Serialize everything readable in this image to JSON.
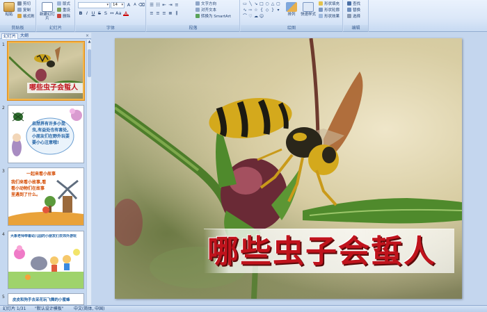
{
  "ribbon": {
    "clipboard": {
      "label": "剪贴板",
      "paste": "粘贴",
      "cut": "剪切",
      "copy": "复制",
      "format_painter": "格式刷"
    },
    "slides": {
      "label": "幻灯片",
      "new_slide": "新建幻灯片",
      "layout": "版式",
      "reset": "重设",
      "delete": "删除"
    },
    "font": {
      "label": "字体",
      "font_size": "14",
      "bold": "B",
      "italic": "I",
      "underline": "U",
      "strike": "S",
      "shadow": "S",
      "increase": "A",
      "decrease": "A"
    },
    "paragraph": {
      "label": "段落",
      "text_direction": "文字方向",
      "align_text": "对齐文本",
      "smartart": "转换为 SmartArt"
    },
    "drawing": {
      "label": "绘图",
      "arrange": "排列",
      "quick_styles": "快速样式",
      "shape_fill": "形状填充",
      "shape_outline": "形状轮廓",
      "shape_effects": "形状效果"
    },
    "editing": {
      "label": "编辑",
      "find": "查找",
      "replace": "替换",
      "select": "选择"
    }
  },
  "left_panel": {
    "tab_slides": "幻灯片",
    "tab_outline": "大纲",
    "close": "×",
    "thumbnails": [
      {
        "number": "1",
        "title": "哪些虫子会蜇人"
      },
      {
        "number": "2",
        "text": "自然界有许多小昆虫,有益处也有害处,小朋友们在野外玩耍要小心注意哦!"
      },
      {
        "number": "3",
        "title": "一起来看小故事",
        "text": "我们来看小故事,看看小动物们在故事里遇到了什么。"
      },
      {
        "number": "4",
        "text": "大象老师带着幼儿园的小朋友们去郊外游玩"
      },
      {
        "number": "5",
        "text": "皮皮和狗手去采花玩飞舞的小蜜蜂"
      }
    ]
  },
  "slide": {
    "title": "哪些虫子会蜇人"
  },
  "statusbar": {
    "slide_info": "幻灯片 1/31",
    "theme": "\"默认设计模板\"",
    "language": "中文(简体, 中国)"
  }
}
